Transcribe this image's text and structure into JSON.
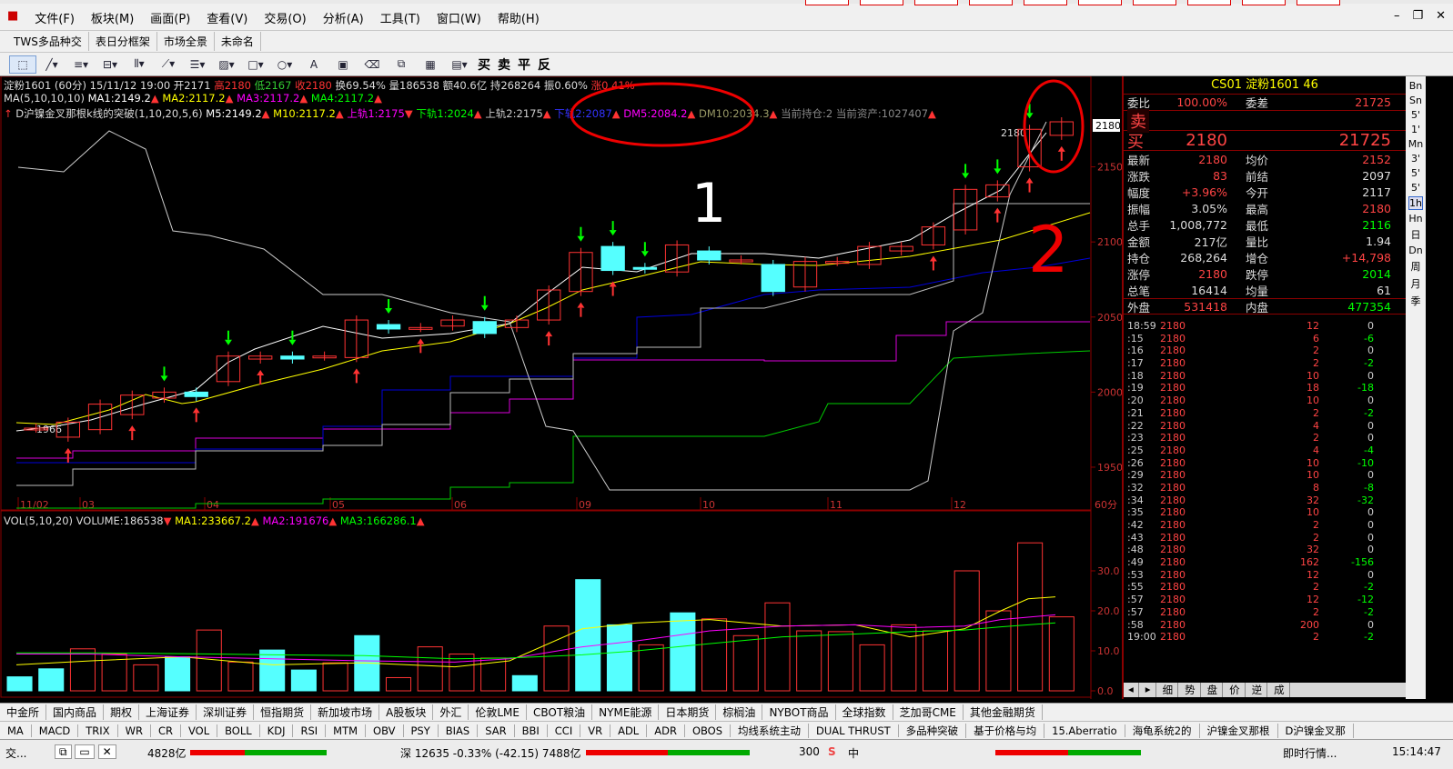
{
  "menu": {
    "items": [
      "文件(F)",
      "板块(M)",
      "画面(P)",
      "查看(V)",
      "交易(O)",
      "分析(A)",
      "工具(T)",
      "窗口(W)",
      "帮助(H)"
    ]
  },
  "tabs": [
    "TWS多品种交",
    "表日分框架",
    "市场全景",
    "未命名"
  ],
  "toolbar": {
    "actions": [
      "买",
      "卖",
      "平",
      "反"
    ]
  },
  "chart": {
    "line1": "淀粉1601 (60分) 15/11/12 19:00 开2171",
    "high": "高2180",
    "low": "低2167",
    "close": "收2180",
    "extra": "换69.54% 量186538 额40.6亿 持268264 振0.60%",
    "change": "涨0.41%",
    "ma_label": "MA(5,10,10,10)",
    "ma1": "MA1:2149.2",
    "ma2": "MA2:2117.2",
    "ma3": "MA3:2117.2",
    "ma4": "MA4:2117.2",
    "strategy_label": "D沪镍金叉那根k线的突破(1,10,20,5,6)",
    "m5": "M5:2149.2",
    "m10": "M10:2117.2",
    "up1": "上轨1:2175",
    "down1": "下轨1:2024",
    "up2": "上轨2:2175",
    "down2": "下轨2:2087",
    "dm5": "DM5:2084.2",
    "dm10": "DM10:2034.3",
    "pos": "当前持仓:2",
    "asset": "当前资产:1027407",
    "price_tag": "2180",
    "y_ticks": [
      "2150",
      "2100",
      "2050",
      "2000",
      "1950"
    ],
    "x_ticks": [
      "11/02",
      "03",
      "04",
      "05",
      "06",
      "09",
      "10",
      "11",
      "12"
    ],
    "period_label": "60分",
    "low_label": "1966",
    "high_label": "2180",
    "vol_label": "VOL(5,10,20) VOLUME:186538",
    "vma1": "MA1:233667.2",
    "vma2": "MA2:191676",
    "vma3": "MA3:166286.1",
    "vol_ticks": [
      "30.0",
      "20.0",
      "10.0",
      "0.0"
    ],
    "annot1": "1",
    "annot2": "2"
  },
  "chart_data": {
    "type": "candlestick",
    "ylim": [
      1930,
      2180
    ],
    "candles": [
      {
        "o": 1976,
        "c": 1976
      },
      {
        "o": 1970,
        "c": 1980
      },
      {
        "o": 1975,
        "c": 1992
      },
      {
        "o": 1985,
        "c": 1998
      },
      {
        "o": 1996,
        "c": 2000
      },
      {
        "o": 2000,
        "c": 1997
      },
      {
        "o": 2007,
        "c": 2024
      },
      {
        "o": 2022,
        "c": 2024
      },
      {
        "o": 2024,
        "c": 2022
      },
      {
        "o": 2024,
        "c": 2024
      },
      {
        "o": 2023,
        "c": 2048
      },
      {
        "o": 2045,
        "c": 2042
      },
      {
        "o": 2043,
        "c": 2043
      },
      {
        "o": 2044,
        "c": 2048
      },
      {
        "o": 2047,
        "c": 2039
      },
      {
        "o": 2043,
        "c": 2048
      },
      {
        "o": 2048,
        "c": 2068
      },
      {
        "o": 2067,
        "c": 2093
      },
      {
        "o": 2097,
        "c": 2081
      },
      {
        "o": 2083,
        "c": 2082
      },
      {
        "o": 2080,
        "c": 2098
      },
      {
        "o": 2094,
        "c": 2088
      },
      {
        "o": 2088,
        "c": 2088
      },
      {
        "o": 2085,
        "c": 2067
      },
      {
        "o": 2070,
        "c": 2087
      },
      {
        "o": 2087,
        "c": 2087
      },
      {
        "o": 2085,
        "c": 2097
      },
      {
        "o": 2094,
        "c": 2097
      },
      {
        "o": 2098,
        "c": 2110
      },
      {
        "o": 2108,
        "c": 2135
      },
      {
        "o": 2130,
        "c": 2138
      },
      {
        "o": 2150,
        "c": 2175
      },
      {
        "o": 2171,
        "c": 2180
      }
    ],
    "volumes": [
      3.5,
      5.5,
      10.5,
      9.2,
      6.5,
      8.5,
      15.2,
      7.2,
      10.2,
      5.2,
      7.0,
      13.8,
      3.3,
      11.0,
      9.2,
      8.2,
      3.8,
      16.2,
      27.8,
      16.5,
      11.5,
      19.5,
      18.0,
      13.8,
      22.0,
      15.0,
      14.8,
      11.5,
      16.5,
      15.0,
      30.0,
      20.0,
      37.0,
      18.5
    ]
  },
  "quote": {
    "title": "CS01  淀粉1601  46",
    "wb_label": "委比",
    "wb_val": "100.00%",
    "wc_label": "委差",
    "wc_val": "21725",
    "sell_label": "卖",
    "buy_label": "买",
    "buy_price": "2180",
    "buy_vol": "21725",
    "rows": [
      {
        "l": "最新",
        "v": "2180",
        "l2": "均价",
        "v2": "2152"
      },
      {
        "l": "涨跌",
        "v": "83",
        "l2": "前结",
        "v2": "2097"
      },
      {
        "l": "幅度",
        "v": "+3.96%",
        "l2": "今开",
        "v2": "2117"
      },
      {
        "l": "振幅",
        "v": "3.05%",
        "l2": "最高",
        "v2": "2180"
      },
      {
        "l": "总手",
        "v": "1,008,772",
        "l2": "最低",
        "v2": "2116"
      },
      {
        "l": "金额",
        "v": "217亿",
        "l2": "量比",
        "v2": "1.94"
      },
      {
        "l": "持仓",
        "v": "268,264",
        "l2": "增仓",
        "v2": "+14,798"
      },
      {
        "l": "涨停",
        "v": "2180",
        "l2": "跌停",
        "v2": "2014"
      },
      {
        "l": "总笔",
        "v": "16414",
        "l2": "均量",
        "v2": "61"
      }
    ],
    "outer_label": "外盘",
    "outer_val": "531418",
    "inner_label": "内盘",
    "inner_val": "477354",
    "ticks": [
      {
        "t": "18:59",
        "p": "2180",
        "v": "12",
        "d": "0"
      },
      {
        "t": ":15",
        "p": "2180",
        "v": "6",
        "d": "-6"
      },
      {
        "t": ":16",
        "p": "2180",
        "v": "2",
        "d": "0"
      },
      {
        "t": ":17",
        "p": "2180",
        "v": "2",
        "d": "-2"
      },
      {
        "t": ":18",
        "p": "2180",
        "v": "10",
        "d": "0"
      },
      {
        "t": ":19",
        "p": "2180",
        "v": "18",
        "d": "-18"
      },
      {
        "t": ":20",
        "p": "2180",
        "v": "10",
        "d": "0"
      },
      {
        "t": ":21",
        "p": "2180",
        "v": "2",
        "d": "-2"
      },
      {
        "t": ":22",
        "p": "2180",
        "v": "4",
        "d": "0"
      },
      {
        "t": ":23",
        "p": "2180",
        "v": "2",
        "d": "0"
      },
      {
        "t": ":25",
        "p": "2180",
        "v": "4",
        "d": "-4"
      },
      {
        "t": ":26",
        "p": "2180",
        "v": "10",
        "d": "-10"
      },
      {
        "t": ":29",
        "p": "2180",
        "v": "10",
        "d": "0"
      },
      {
        "t": ":32",
        "p": "2180",
        "v": "8",
        "d": "-8"
      },
      {
        "t": ":34",
        "p": "2180",
        "v": "32",
        "d": "-32"
      },
      {
        "t": ":35",
        "p": "2180",
        "v": "10",
        "d": "0"
      },
      {
        "t": ":42",
        "p": "2180",
        "v": "2",
        "d": "0"
      },
      {
        "t": ":43",
        "p": "2180",
        "v": "2",
        "d": "0"
      },
      {
        "t": ":48",
        "p": "2180",
        "v": "32",
        "d": "0"
      },
      {
        "t": ":49",
        "p": "2180",
        "v": "162",
        "d": "-156"
      },
      {
        "t": ":53",
        "p": "2180",
        "v": "12",
        "d": "0"
      },
      {
        "t": ":55",
        "p": "2180",
        "v": "2",
        "d": "-2"
      },
      {
        "t": ":57",
        "p": "2180",
        "v": "12",
        "d": "-12"
      },
      {
        "t": ":57",
        "p": "2180",
        "v": "2",
        "d": "-2"
      },
      {
        "t": ":58",
        "p": "2180",
        "v": "200",
        "d": "0"
      },
      {
        "t": "19:00",
        "p": "2180",
        "v": "2",
        "d": "-2"
      }
    ],
    "tabs": [
      "细",
      "势",
      "盘",
      "价",
      "逆",
      "成"
    ]
  },
  "side_strip": [
    "Bn",
    "Sn",
    "5'",
    "1'",
    "Mn",
    "3'",
    "5'",
    "5'",
    "1h",
    "Hn",
    "日",
    "Dn",
    "周",
    "月",
    "季"
  ],
  "bottom_tabs1": [
    "中金所",
    "国内商品",
    "期权",
    "上海证券",
    "深圳证券",
    "恒指期货",
    "新加坡市场",
    "A股板块",
    "外汇",
    "伦敦LME",
    "CBOT粮油",
    "NYME能源",
    "日本期货",
    "棕榈油",
    "NYBOT商品",
    "全球指数",
    "芝加哥CME",
    "其他金融期货"
  ],
  "bottom_tabs2": [
    "MA",
    "MACD",
    "TRIX",
    "WR",
    "CR",
    "VOL",
    "BOLL",
    "KDJ",
    "RSI",
    "MTM",
    "OBV",
    "PSY",
    "BIAS",
    "SAR",
    "BBI",
    "CCI",
    "VR",
    "ADL",
    "ADR",
    "OBOS",
    "均线系统主动",
    "DUAL THRUST",
    "多品种突破",
    "基于价格与均",
    "15.Aberratio",
    "海龟系统2的",
    "沪镍金叉那根",
    "D沪镍金叉那"
  ],
  "status": {
    "left": "交...",
    "v1": "4828亿",
    "sz": "深  12635  -0.33%  (-42.15)  7488亿",
    "v3": "300",
    "ime": "中",
    "realtime": "即时行情...",
    "time": "15:14:47"
  }
}
